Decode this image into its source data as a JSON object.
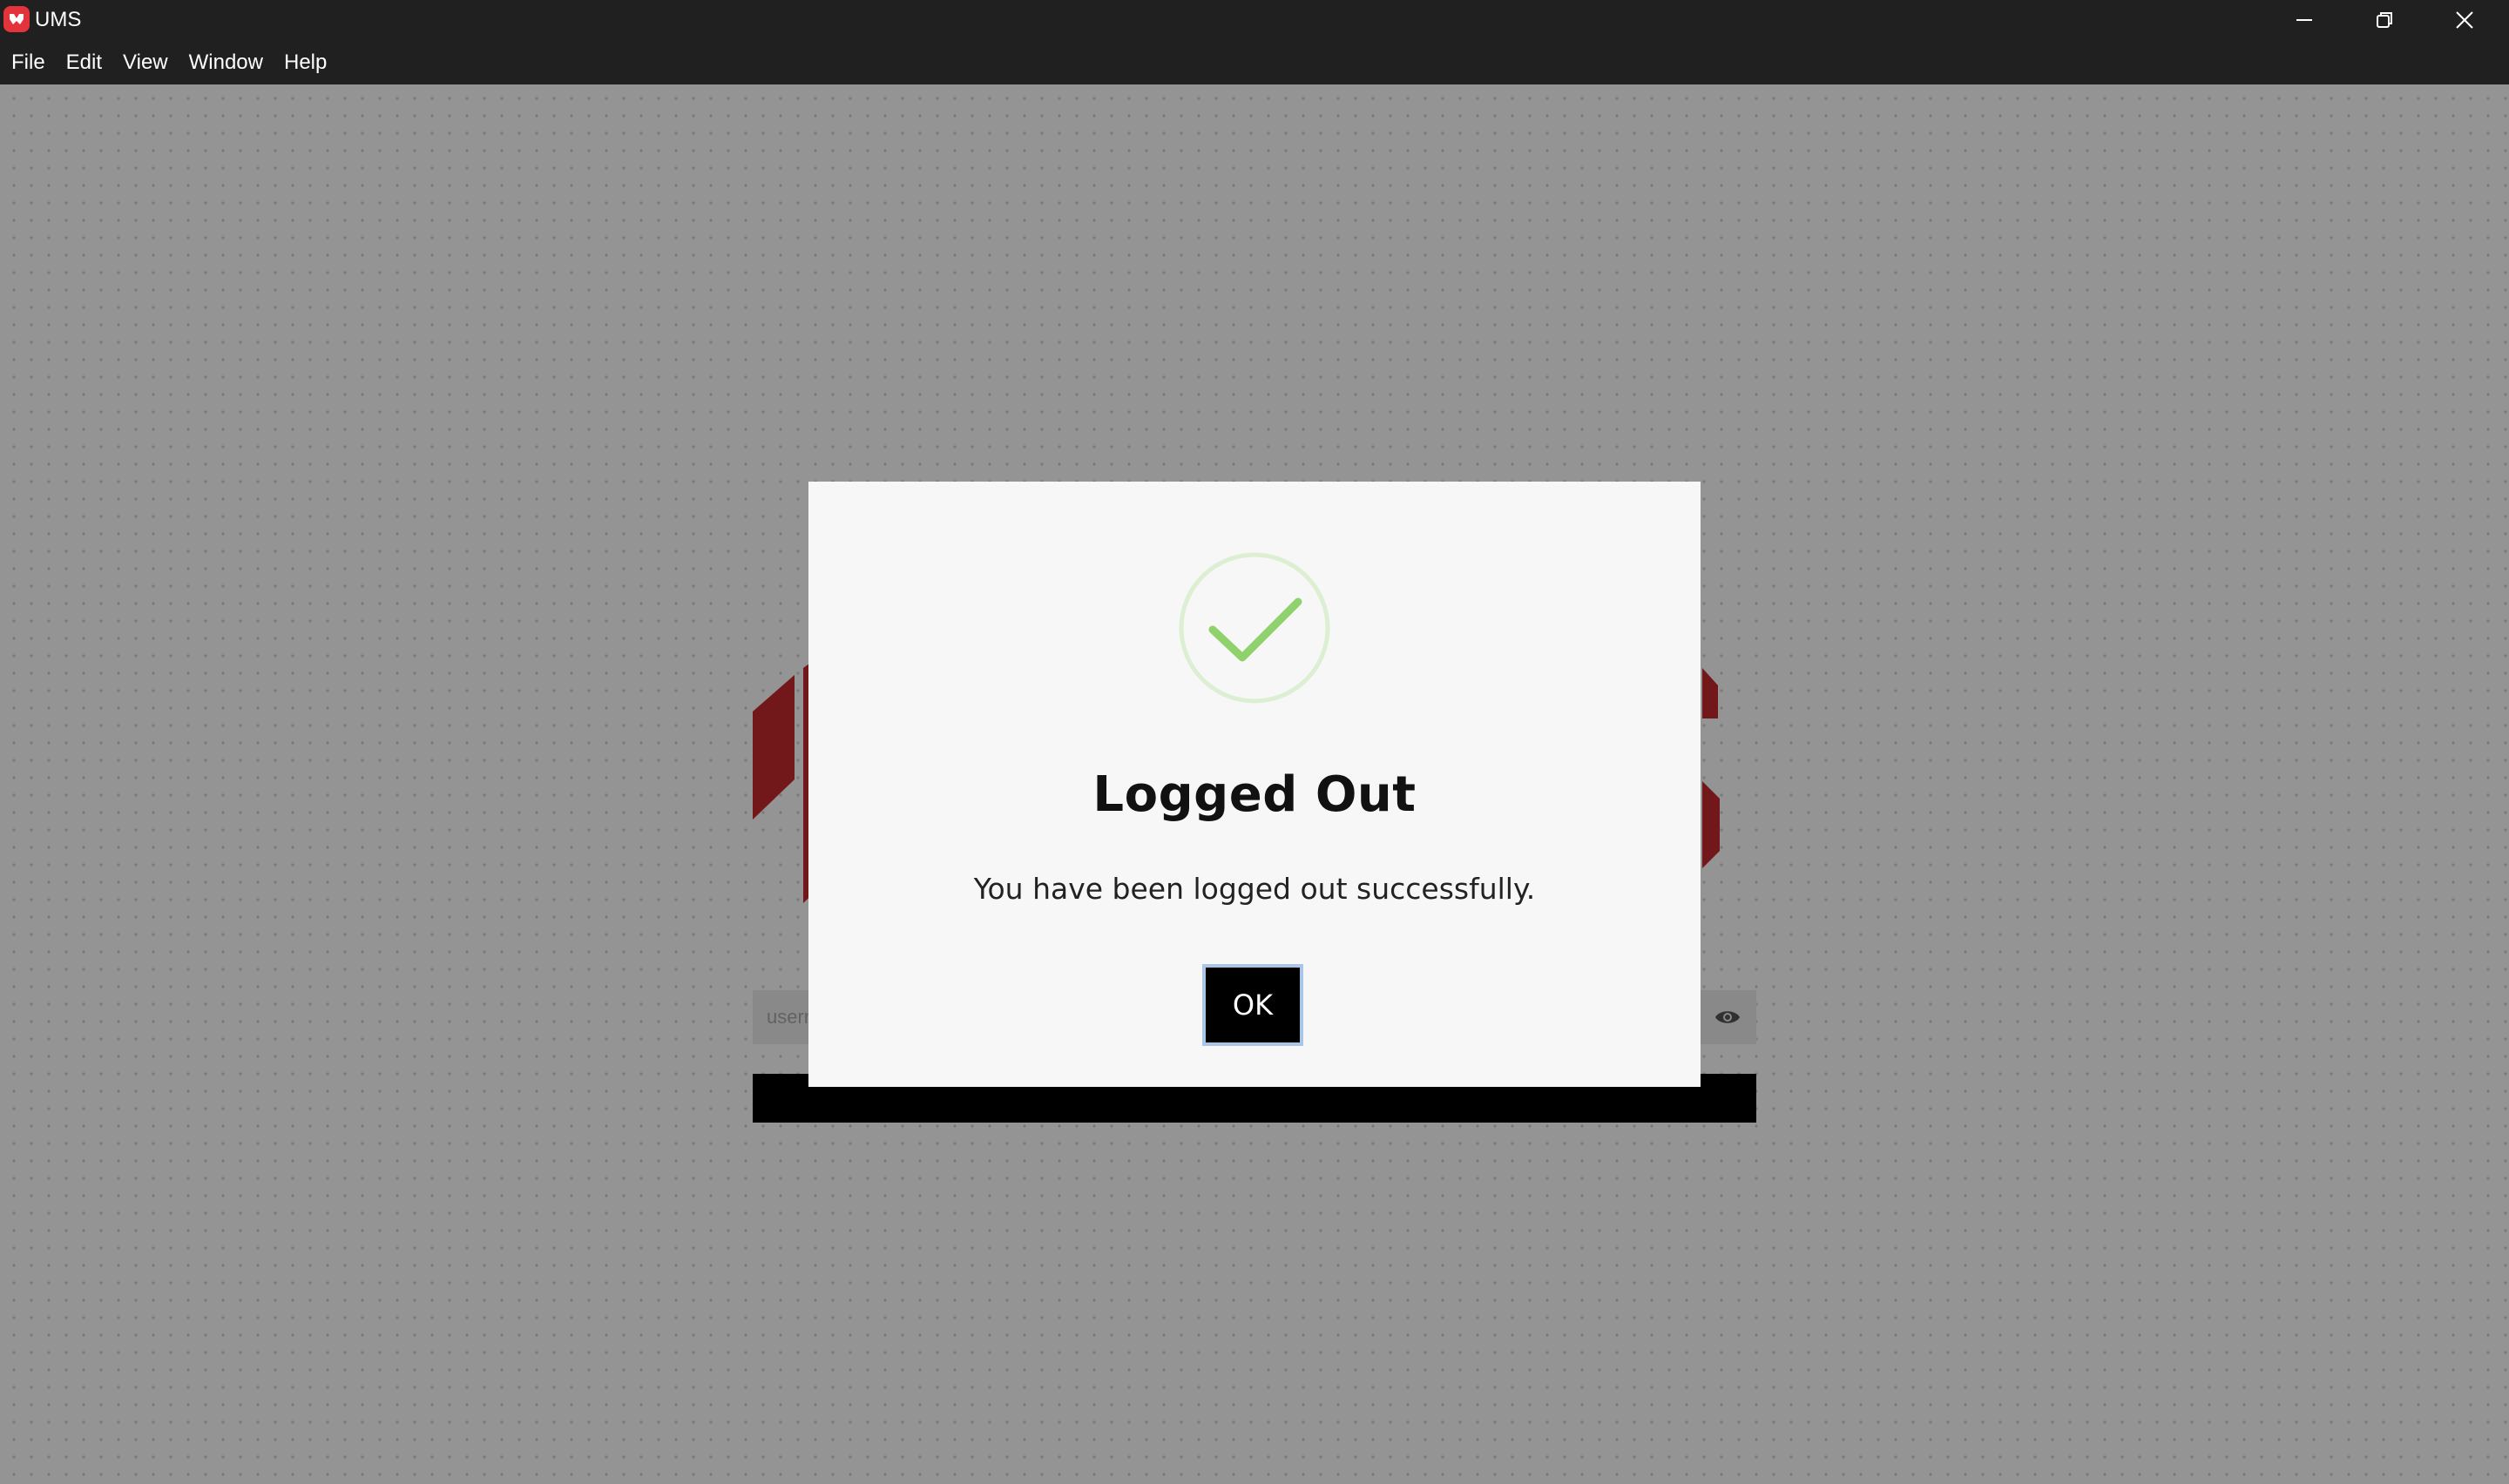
{
  "window": {
    "title": "UMS",
    "controls": {
      "minimize_icon": "minimize-icon",
      "maximize_icon": "restore-icon",
      "close_icon": "close-icon"
    }
  },
  "menubar": {
    "items": [
      "File",
      "Edit",
      "View",
      "Window",
      "Help"
    ]
  },
  "login": {
    "username_placeholder": "username",
    "password_toggle_icon": "eye-icon",
    "brand_color": "#c42a2e"
  },
  "modal": {
    "icon": "check-circle-icon",
    "icon_color": "#8fd16a",
    "title": "Logged Out",
    "message": "You have been logged out successfully.",
    "ok_label": "OK"
  }
}
